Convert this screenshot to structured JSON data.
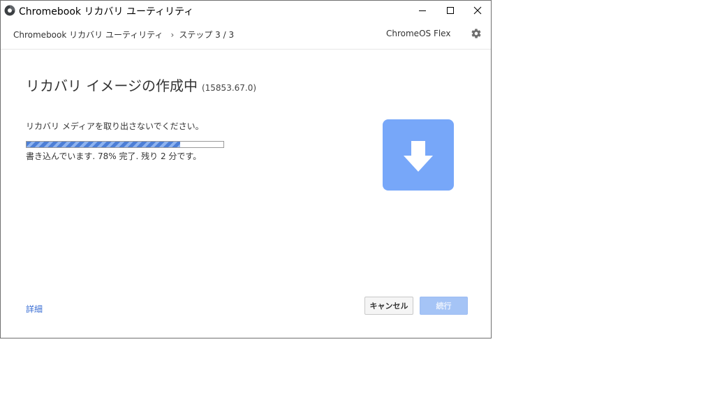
{
  "window": {
    "title": "Chromebook リカバリ ユーティリティ",
    "controls": {
      "minimize": "minimize-icon",
      "maximize": "maximize-icon",
      "close": "close-icon"
    }
  },
  "header": {
    "breadcrumb_app": "Chromebook リカバリ ユーティリティ",
    "breadcrumb_separator": "›",
    "breadcrumb_step": "ステップ 3 / 3",
    "device": "ChromeOS Flex",
    "settings_icon": "gear-icon"
  },
  "main": {
    "heading": "リカバリ イメージの作成中",
    "version": "(15853.67.0)",
    "instruction": "リカバリ メディアを取り出さないでください。",
    "progress_percent": 78,
    "progress_text": "書き込んでいます. 78% 完了. 残り 2 分です。",
    "status_icon": "download-arrow-icon"
  },
  "footer": {
    "details_link": "詳細",
    "cancel_label": "キャンセル",
    "continue_label": "続行"
  },
  "colors": {
    "accent": "#77a7f9",
    "progress": "#4d7fd6",
    "link": "#3b6fd4",
    "continue_disabled": "#a5c4f6"
  }
}
